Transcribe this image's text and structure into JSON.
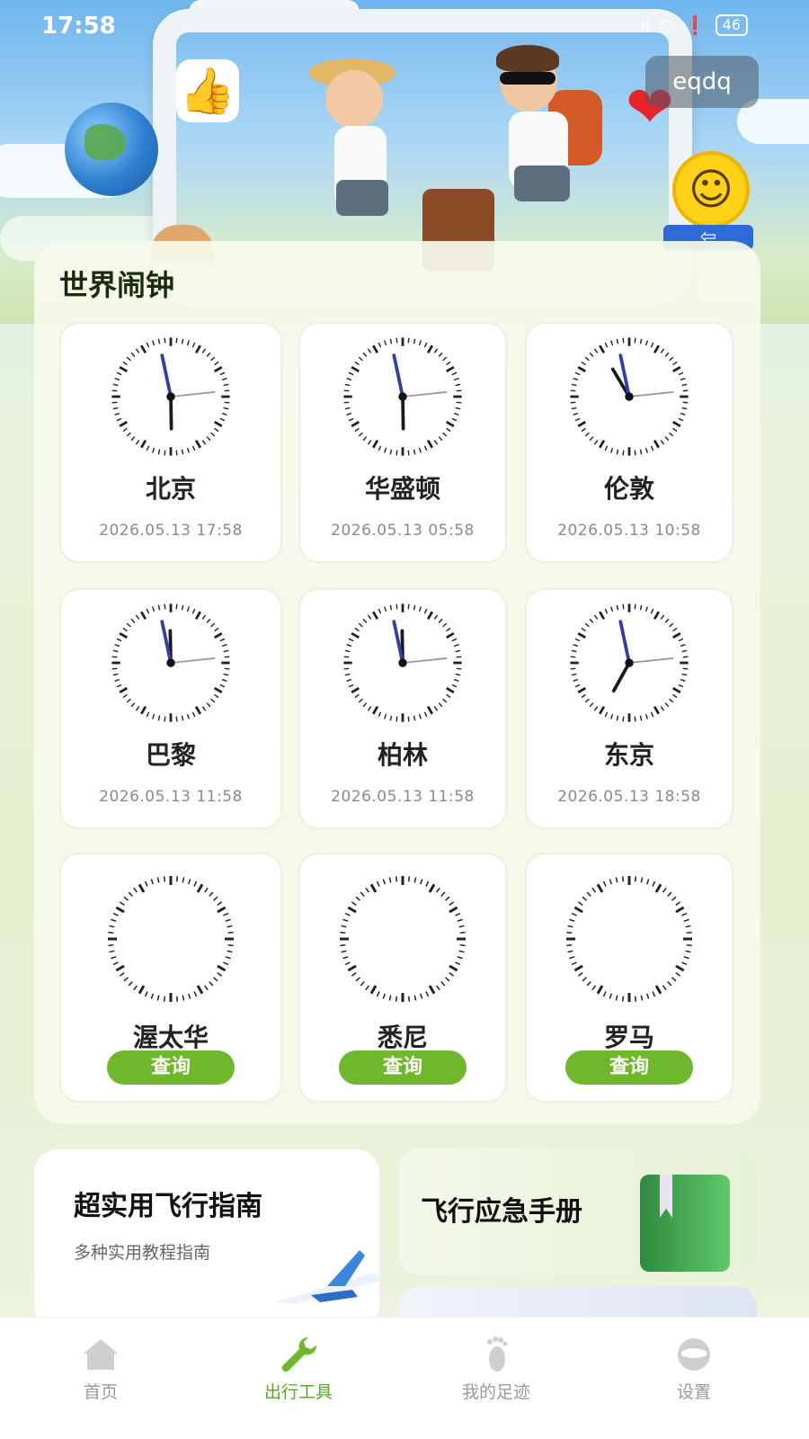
{
  "status_bar": {
    "time": "17:58",
    "battery": "46"
  },
  "user": {
    "name": "eqdq"
  },
  "world_clock": {
    "title": "世界闹钟",
    "cities": [
      {
        "name": "北京",
        "datetime": "2026.05.13 17:58",
        "hour": 17,
        "minute": 58,
        "second": 14
      },
      {
        "name": "华盛顿",
        "datetime": "2026.05.13 05:58",
        "hour": 5,
        "minute": 58,
        "second": 14
      },
      {
        "name": "伦敦",
        "datetime": "2026.05.13 10:58",
        "hour": 10,
        "minute": 58,
        "second": 14
      },
      {
        "name": "巴黎",
        "datetime": "2026.05.13 11:58",
        "hour": 11,
        "minute": 58,
        "second": 14
      },
      {
        "name": "柏林",
        "datetime": "2026.05.13 11:58",
        "hour": 11,
        "minute": 58,
        "second": 14
      },
      {
        "name": "东京",
        "datetime": "2026.05.13 18:58",
        "hour": 18,
        "minute": 58,
        "second": 14
      },
      {
        "name": "渥太华",
        "query_label": "查询"
      },
      {
        "name": "悉尼",
        "query_label": "查询"
      },
      {
        "name": "罗马",
        "query_label": "查询"
      }
    ]
  },
  "promos": {
    "guide": {
      "title": "超实用飞行指南",
      "subtitle": "多种实用教程指南"
    },
    "emergency": {
      "title": "飞行应急手册"
    }
  },
  "tabs": [
    {
      "label": "首页",
      "icon": "home-icon",
      "active": false
    },
    {
      "label": "出行工具",
      "icon": "wrench-icon",
      "active": true
    },
    {
      "label": "我的足迹",
      "icon": "footprint-icon",
      "active": false
    },
    {
      "label": "设置",
      "icon": "settings-icon",
      "active": false
    }
  ],
  "colors": {
    "accent": "#6fb82c",
    "hour_hand": "#2d3fa8",
    "hand_dark": "#1a1a1a",
    "second_hand": "#9a9a9a"
  }
}
